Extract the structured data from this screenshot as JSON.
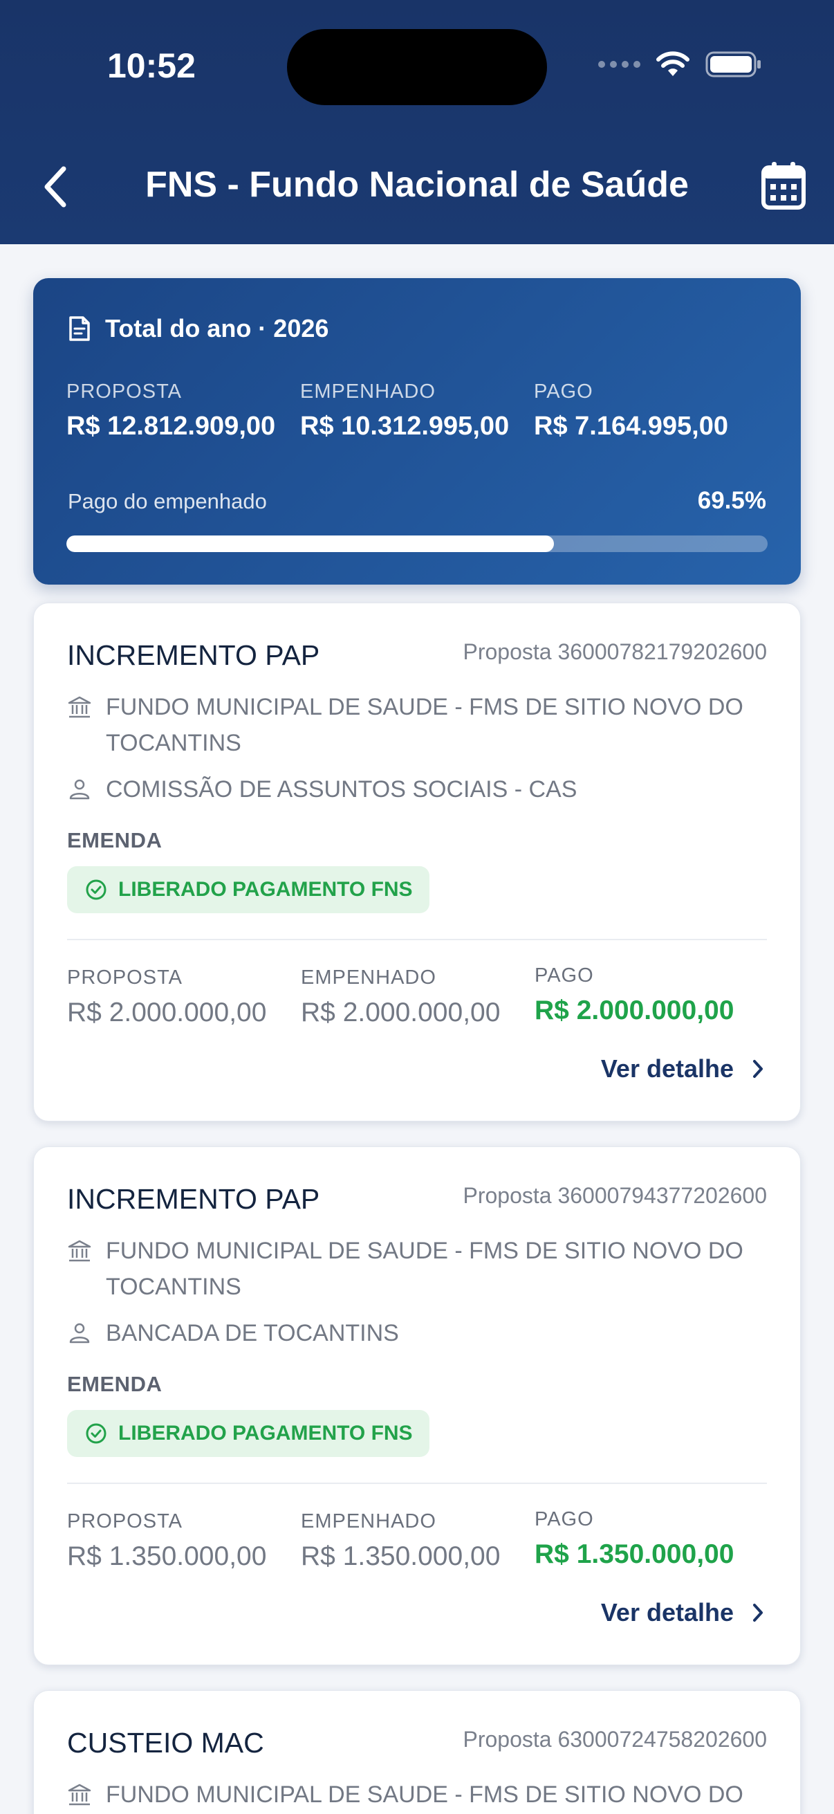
{
  "status_bar": {
    "time": "10:52"
  },
  "header": {
    "title": "FNS - Fundo Nacional de Saúde"
  },
  "summary": {
    "heading": "Total do ano · 2026",
    "proposta_label": "PROPOSTA",
    "proposta_value": "R$ 12.812.909,00",
    "empenhado_label": "EMPENHADO",
    "empenhado_value": "R$ 10.312.995,00",
    "pago_label": "PAGO",
    "pago_value": "R$ 7.164.995,00",
    "progress_label": "Pago do empenhado",
    "progress_pct": "69.5%",
    "progress_fraction": 0.695
  },
  "cards": [
    {
      "title": "INCREMENTO PAP",
      "proposta": "Proposta 36000782179202600",
      "entity": "FUNDO MUNICIPAL DE SAUDE - FMS DE SITIO NOVO DO TOCANTINS",
      "author": "COMISSÃO DE ASSUNTOS SOCIAIS - CAS",
      "type": "EMENDA",
      "status": "LIBERADO PAGAMENTO FNS",
      "proposta_label": "PROPOSTA",
      "proposta_value": "R$ 2.000.000,00",
      "empenhado_label": "EMPENHADO",
      "empenhado_value": "R$ 2.000.000,00",
      "pago_label": "PAGO",
      "pago_value": "R$ 2.000.000,00",
      "link": "Ver detalhe"
    },
    {
      "title": "INCREMENTO PAP",
      "proposta": "Proposta 36000794377202600",
      "entity": "FUNDO MUNICIPAL DE SAUDE - FMS DE SITIO NOVO DO TOCANTINS",
      "author": "BANCADA DE TOCANTINS",
      "type": "EMENDA",
      "status": "LIBERADO PAGAMENTO FNS",
      "proposta_label": "PROPOSTA",
      "proposta_value": "R$ 1.350.000,00",
      "empenhado_label": "EMPENHADO",
      "empenhado_value": "R$ 1.350.000,00",
      "pago_label": "PAGO",
      "pago_value": "R$ 1.350.000,00",
      "link": "Ver detalhe"
    },
    {
      "title": "CUSTEIO MAC",
      "proposta": "Proposta 63000724758202600",
      "entity": "FUNDO MUNICIPAL DE SAUDE - FMS DE SITIO NOVO DO"
    }
  ],
  "colors": {
    "header": "#1b3a72",
    "summary_start": "#1b4585",
    "summary_end": "#2763ab",
    "success": "#1fa34a",
    "badge_bg": "#e4f5e8",
    "link": "#1a3466"
  },
  "icons": {
    "back": "chevron-left-icon",
    "calendar": "calendar-icon",
    "document": "document-icon",
    "institution": "bank-icon",
    "person": "person-icon",
    "check": "check-circle-icon",
    "chevron": "chevron-right-icon"
  }
}
